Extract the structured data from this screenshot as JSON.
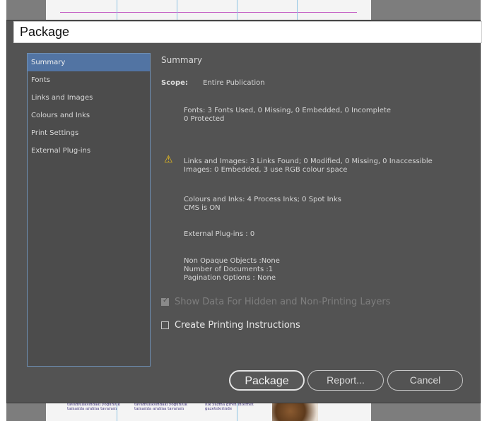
{
  "dialog": {
    "title": "Package"
  },
  "sidebar": {
    "items": [
      {
        "label": "Summary"
      },
      {
        "label": "Fonts"
      },
      {
        "label": "Links and Images"
      },
      {
        "label": "Colours and Inks"
      },
      {
        "label": "Print Settings"
      },
      {
        "label": "External Plug-ins"
      }
    ],
    "active_index": 0
  },
  "summary": {
    "heading": "Summary",
    "scope_label": "Scope:",
    "scope_value": "Entire Publication",
    "fonts": {
      "line1": "Fonts: 3 Fonts Used, 0 Missing, 0 Embedded, 0 Incomplete",
      "line2": "0 Protected"
    },
    "links": {
      "line1": "Links and Images: 3 Links Found; 0 Modified, 0 Missing, 0 Inaccessible",
      "line2": "Images: 0 Embedded, 3 use RGB colour space",
      "icon": "warning-icon"
    },
    "colours": {
      "line1": "Colours and Inks: 4 Process Inks; 0 Spot Inks",
      "line2": "CMS is ON"
    },
    "plugins": {
      "line1": "External Plug-ins : 0"
    },
    "misc": {
      "line1": "Non Opaque Objects :None",
      "line2": "Number of Documents :1",
      "line3": "Pagination Options : None"
    },
    "show_hidden_layers": {
      "label": "Show Data For Hidden and Non-Printing Layers",
      "checked": true,
      "enabled": false
    },
    "create_printing_instructions": {
      "label": "Create Printing Instructions",
      "checked": false,
      "enabled": true
    }
  },
  "buttons": {
    "package": "Package",
    "report": "Report...",
    "cancel": "Cancel"
  },
  "background_document": {
    "snippets": [
      "tavamuliksindaki yoğunluk tamamla aralma tavaram",
      "tavamuliksindaki yoğunluk tamamla aralma tavaram",
      "lük yazma giren internet gazetelerinde"
    ]
  },
  "colors": {
    "dialog_bg": "#535353",
    "sidebar_selection": "#5274a3",
    "warning": "#f2c31b"
  }
}
